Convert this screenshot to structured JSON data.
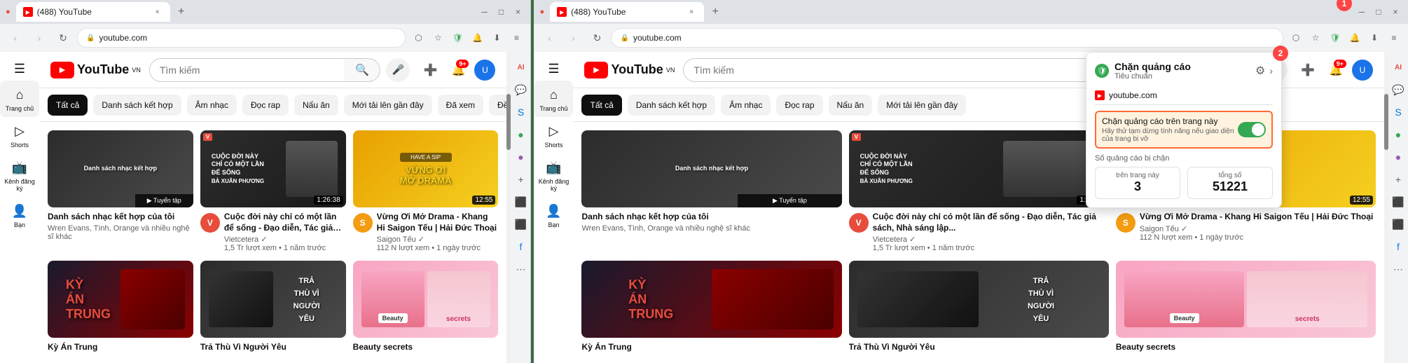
{
  "left_panel": {
    "tab": {
      "favicon": "▶",
      "title": "(488) YouTube",
      "close": "×"
    },
    "address": "youtube.com",
    "marker1": "1",
    "header": {
      "logo_text": "YouTube",
      "logo_vn": "VN",
      "search_placeholder": "Tìm kiếm"
    },
    "filter_chips": [
      {
        "label": "Tất cả",
        "active": true
      },
      {
        "label": "Danh sách kết hợp",
        "active": false
      },
      {
        "label": "Âm nhạc",
        "active": false
      },
      {
        "label": "Đọc rap",
        "active": false
      },
      {
        "label": "Nấu ăn",
        "active": false
      },
      {
        "label": "Mới tải lên gần đây",
        "active": false
      },
      {
        "label": "Đã xem",
        "active": false
      },
      {
        "label": "Đề xuất mới",
        "active": false
      }
    ],
    "videos_row1": [
      {
        "id": "v1",
        "title": "Danh sách nhạc kết hợp của tôi",
        "channel": "Wren Evans, Tình, Orange và nhiều nghệ sĩ khác",
        "stats": "",
        "duration": "",
        "badge": "",
        "thumb_type": "dark",
        "has_playlist": true
      },
      {
        "id": "v2",
        "title": "Cuộc đời này chỉ có một lần để sống - Đạo diễn, Tác giả sách, Nhà sáng lập...",
        "channel": "Vietcetera ✓",
        "stats": "1,5 Tr lượt xem • 1 năm trước",
        "duration": "1:26:38",
        "badge": "",
        "thumb_type": "vietcetera",
        "overlay_text": "CUỘC ĐỜI NÀY\nCHỈ CÓ MỘT LẦN\nĐỂ SỐNG\nBÀ XUÂN PHƯƠNG"
      },
      {
        "id": "v3",
        "title": "Vừng Ơi Mở Drama - Khang Hi Saigon Tếu | Hải Đức Thoại",
        "channel": "Saigon Tếu ✓",
        "stats": "112 N lượt xem • 1 ngày trước",
        "duration": "12:55",
        "badge": "HAVE A SIP",
        "thumb_type": "drama",
        "overlay_text": "VỪNG ƠI\nMỞ DRAMA"
      }
    ],
    "videos_row2": [
      {
        "id": "v4",
        "title": "Kỳ Án Trung",
        "channel": "",
        "stats": "",
        "duration": "",
        "thumb_type": "red",
        "overlay_text": "KỲ\nÁN\nTRUNG"
      },
      {
        "id": "v5",
        "title": "Trả Thù Vì Người Yêu",
        "channel": "",
        "stats": "",
        "duration": "",
        "thumb_type": "dark",
        "overlay_text": "TRẢ\nTHÙ VÌ\nNGƯỜI\nYÊU"
      },
      {
        "id": "v6",
        "title": "Beauty secrets",
        "channel": "",
        "stats": "",
        "duration": "",
        "thumb_type": "beauty",
        "overlay_text": "Beauty secrets"
      }
    ],
    "notif_count": "9+"
  },
  "right_panel": {
    "tab": {
      "favicon": "▶",
      "title": "(488) YouTube",
      "close": "×"
    },
    "address": "youtube.com",
    "marker2": "2",
    "popup": {
      "shield_icon": "🛡",
      "title": "Chặn quảng cáo",
      "subtitle": "Tiêu chuẩn",
      "site": "youtube.com",
      "toggle_label": "Chặn quảng cáo trên trang này",
      "toggle_subtext": "Hãy thử tạm dừng tính năng nếu giao diện của trang bị vỡ",
      "counter_title": "Số quảng cáo bị chặn",
      "counter_this_page_label": "trên trang này",
      "counter_this_page_value": "3",
      "counter_total_label": "tổng số",
      "counter_total_value": "51221"
    },
    "filter_chips": [
      {
        "label": "Tất cả",
        "active": true
      },
      {
        "label": "Danh sách kết hợp",
        "active": false
      },
      {
        "label": "Âm nhạc",
        "active": false
      },
      {
        "label": "Đọc rap",
        "active": false
      },
      {
        "label": "Nấu ăn",
        "active": false
      },
      {
        "label": "Mới tải lên gần đây",
        "active": false
      }
    ],
    "notif_count": "9+"
  }
}
